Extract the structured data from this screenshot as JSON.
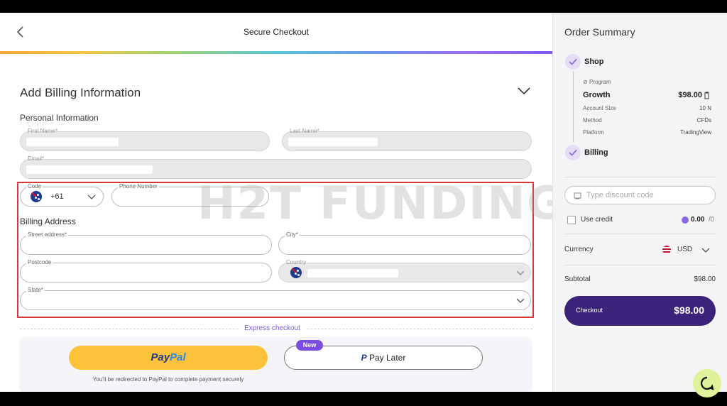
{
  "header": {
    "title": "Secure Checkout"
  },
  "billing": {
    "section_title": "Add Billing Information",
    "personal_title": "Personal Information",
    "first_name_label": "First Name*",
    "last_name_label": "Last Name*",
    "email_label": "Email*",
    "code_label": "Code",
    "code_value": "+61",
    "phone_label": "Phone Number",
    "address_title": "Billing Address",
    "street_label": "Street address*",
    "city_label": "City*",
    "postcode_label": "Postcode",
    "country_label": "Country",
    "state_label": "State*"
  },
  "watermark": "H2T FUNDING",
  "express": {
    "label": "Express checkout",
    "paypal_part1": "Pay",
    "paypal_part2": "Pal",
    "new_badge": "New",
    "pay_later": "Pay Later",
    "redirect_note": "You'll be redirected to PayPal to complete payment securely"
  },
  "summary": {
    "title": "Order Summary",
    "step_shop": "Shop",
    "program_label": "Program",
    "program_name": "Growth",
    "program_price": "$98.00",
    "rows": [
      {
        "label": "Account Size",
        "value": "10 N"
      },
      {
        "label": "Method",
        "value": "CFDs"
      },
      {
        "label": "Platform",
        "value": "TradingView"
      }
    ],
    "step_billing": "Billing",
    "discount_placeholder": "Type discount code",
    "use_credit": "Use credit",
    "credit_amount": "0.00",
    "credit_suffix": "/0",
    "currency_label": "Currency",
    "currency_value": "USD",
    "subtotal_label": "Subtotal",
    "subtotal_value": "$98.00",
    "checkout_label": "Checkout",
    "checkout_amount": "$98.00"
  },
  "colors": {
    "accent": "#3a2378",
    "paypal": "#fbc23a",
    "highlight": "#d93636"
  }
}
